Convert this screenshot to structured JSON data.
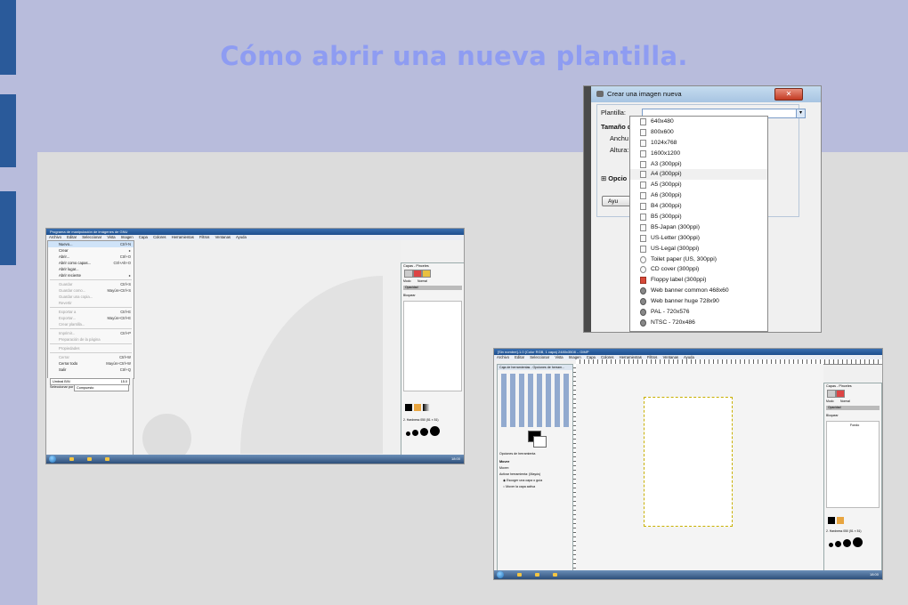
{
  "slide": {
    "title": "Cómo abrir una nueva plantilla."
  },
  "screenshot_menu": {
    "window_title": "Programa de manipulación de imágenes de GNU",
    "menu_bar": [
      "Archivo",
      "Editar",
      "Seleccionar",
      "Vista",
      "Imagen",
      "Capa",
      "Colores",
      "Herramientas",
      "Filtros",
      "Ventanas",
      "Ayuda"
    ],
    "file_menu": [
      {
        "label": "Nuevo...",
        "shortcut": "Ctrl+N",
        "state": "highlight"
      },
      {
        "label": "Crear",
        "shortcut": "▸",
        "state": "normal"
      },
      {
        "label": "Abrir...",
        "shortcut": "Ctrl+O",
        "state": "normal"
      },
      {
        "label": "Abrir como capas...",
        "shortcut": "Ctrl+Alt+O",
        "state": "normal"
      },
      {
        "label": "Abrir lugar...",
        "shortcut": "",
        "state": "normal"
      },
      {
        "label": "Abrir reciente",
        "shortcut": "▸",
        "state": "normal"
      },
      {
        "label": "Guardar",
        "shortcut": "Ctrl+S",
        "state": "disabled"
      },
      {
        "label": "Guardar como...",
        "shortcut": "Mayús+Ctrl+S",
        "state": "disabled"
      },
      {
        "label": "Guardar una copia...",
        "shortcut": "",
        "state": "disabled"
      },
      {
        "label": "Revertir",
        "shortcut": "",
        "state": "disabled"
      },
      {
        "label": "Exportar a",
        "shortcut": "Ctrl+E",
        "state": "disabled"
      },
      {
        "label": "Exportar...",
        "shortcut": "Mayús+Ctrl+E",
        "state": "disabled"
      },
      {
        "label": "Crear plantilla...",
        "shortcut": "",
        "state": "disabled"
      },
      {
        "label": "Imprimir...",
        "shortcut": "Ctrl+P",
        "state": "disabled"
      },
      {
        "label": "Preparación de la página",
        "shortcut": "",
        "state": "disabled"
      },
      {
        "label": "Propiedades",
        "shortcut": "",
        "state": "disabled"
      },
      {
        "label": "Cerrar",
        "shortcut": "Ctrl+W",
        "state": "disabled"
      },
      {
        "label": "Cerrar todo",
        "shortcut": "Mayús+Ctrl+W",
        "state": "normal"
      },
      {
        "label": "Salir",
        "shortcut": "Ctrl+Q",
        "state": "normal"
      }
    ],
    "left_field": {
      "label": "Umbral B/N",
      "value": "15.0"
    },
    "left_select": {
      "label": "Seleccionar por",
      "value": "Compuesto"
    },
    "layers_title": "Capas - Pinceles",
    "layers_mode": "Modo",
    "layers_mode_value": "Normal",
    "layers_opacity": "Opacidad",
    "layers_lock": "Bloquear",
    "brush_label": "2. Hardness 050 (51 × 51)"
  },
  "screenshot_dialog": {
    "title": "Crear una imagen nueva",
    "close_glyph": "✕",
    "template_label": "Plantilla:",
    "size_label": "Tamaño d",
    "width_label": "Anchu",
    "height_label": "Altura:",
    "options_label": "Opcio",
    "help_button": "Ayu",
    "combo_arrow": "▾",
    "templates": [
      {
        "label": "640x480",
        "icon": "file"
      },
      {
        "label": "800x600",
        "icon": "file"
      },
      {
        "label": "1024x768",
        "icon": "file"
      },
      {
        "label": "1600x1200",
        "icon": "file"
      },
      {
        "label": "A3 (300ppi)",
        "icon": "file"
      },
      {
        "label": "A4 (300ppi)",
        "icon": "file"
      },
      {
        "label": "A5 (300ppi)",
        "icon": "file"
      },
      {
        "label": "A6 (300ppi)",
        "icon": "file"
      },
      {
        "label": "B4 (300ppi)",
        "icon": "file"
      },
      {
        "label": "B5 (300ppi)",
        "icon": "file"
      },
      {
        "label": "B5-Japan (300ppi)",
        "icon": "file"
      },
      {
        "label": "US-Letter (300ppi)",
        "icon": "file"
      },
      {
        "label": "US-Legal (300ppi)",
        "icon": "file"
      },
      {
        "label": "Toilet paper (US, 300ppi)",
        "icon": "toilet"
      },
      {
        "label": "CD cover (300ppi)",
        "icon": "cd"
      },
      {
        "label": "Floppy label (300ppi)",
        "icon": "floppy"
      },
      {
        "label": "Web banner common 468x60",
        "icon": "web"
      },
      {
        "label": "Web banner huge 728x90",
        "icon": "web"
      },
      {
        "label": "PAL - 720x576",
        "icon": "video"
      },
      {
        "label": "NTSC - 720x486",
        "icon": "video"
      }
    ],
    "highlighted_index": 5
  },
  "screenshot_canvas": {
    "window_title": "[Sin nombre]-1.0 (Color RGB, 1 capa) 2480x3508 – GIMP",
    "menu_bar": [
      "Archivo",
      "Editar",
      "Seleccionar",
      "Vista",
      "Imagen",
      "Capa",
      "Colores",
      "Herramientas",
      "Filtros",
      "Ventanas",
      "Ayuda"
    ],
    "toolbox_title": "Caja de herramientas - Opciones de herram...",
    "tool_options_tab": "Opciones de herramienta",
    "tool_name": "Mover",
    "tool_mode": "Mover:",
    "tool_active": "Activar herramienta: (Mayús)",
    "radio_1": "Escoger una capa o guía",
    "radio_2": "Mover la capa activa",
    "layers_title": "Capas - Pinceles",
    "layers_mode": "Modo",
    "layers_mode_value": "Normal",
    "layers_opacity": "Opacidad",
    "layers_lock": "Bloquear",
    "layer_name": "Fondo",
    "brush_label": "2. Hardness 050 (51 × 51)"
  },
  "taskbar": {
    "clock": "18:00"
  }
}
